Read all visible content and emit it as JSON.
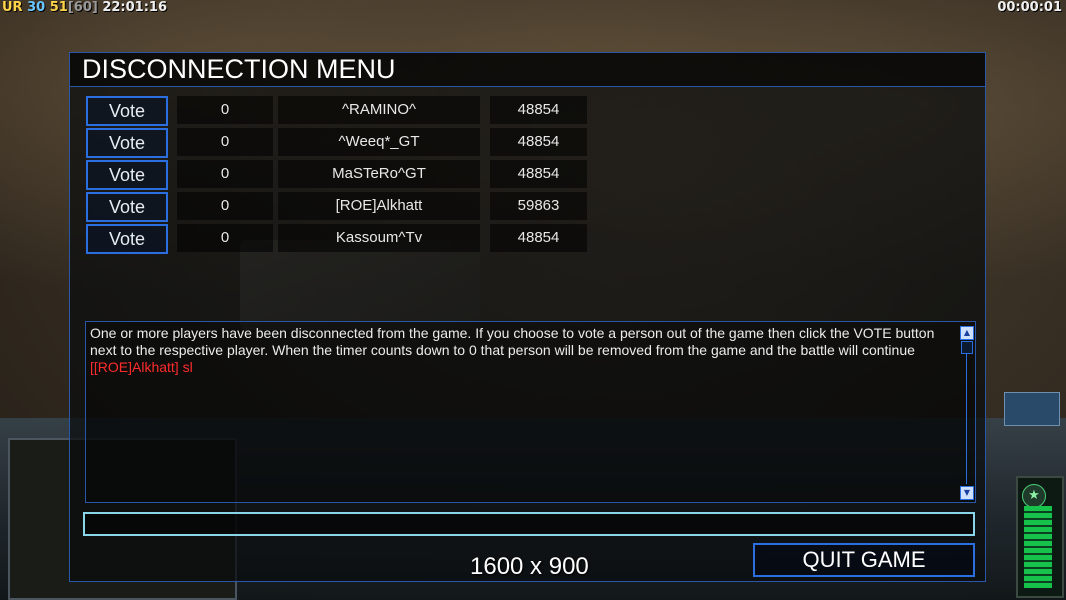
{
  "hud": {
    "top_left": {
      "tag": "UR",
      "a": "30",
      "b": "51",
      "c": "[60]",
      "time": "22:01:16"
    },
    "top_right": {
      "timer": "00:00:01"
    }
  },
  "dialog": {
    "title": "DISCONNECTION MENU",
    "players": [
      {
        "vote_label": "Vote",
        "count": "0",
        "name": "^RAMINO^",
        "value": "48854"
      },
      {
        "vote_label": "Vote",
        "count": "0",
        "name": "^Weeq*_GT",
        "value": "48854"
      },
      {
        "vote_label": "Vote",
        "count": "0",
        "name": "MaSTeRo^GT",
        "value": "48854"
      },
      {
        "vote_label": "Vote",
        "count": "0",
        "name": "[ROE]Alkhatt",
        "value": "59863"
      },
      {
        "vote_label": "Vote",
        "count": "0",
        "name": "Kassoum^Tv",
        "value": "48854"
      }
    ],
    "message": "One or more players have been disconnected from the game. If you choose to vote a person out of the game then click the VOTE button next to the respective player. When the timer counts down to 0 that person will be removed from the game and the battle will continue",
    "chat_line": "[[ROE]Alkhatt] sl",
    "chat_placeholder": "",
    "quit_label": "QUIT GAME",
    "resolution": "1600 x 900"
  },
  "colors": {
    "accent": "#2b6ee0",
    "chat": "#ff2b2b",
    "input_border": "#8ad6e8"
  }
}
